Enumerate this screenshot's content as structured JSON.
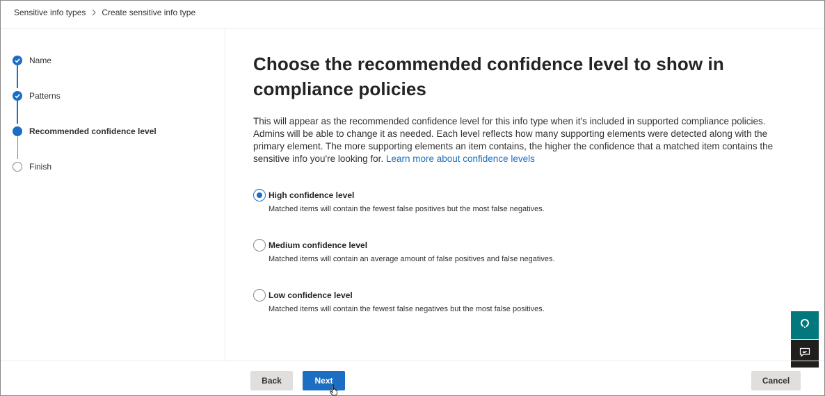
{
  "breadcrumb": {
    "items": [
      "Sensitive info types",
      "Create sensitive info type"
    ]
  },
  "steps": [
    {
      "label": "Name",
      "state": "done"
    },
    {
      "label": "Patterns",
      "state": "done"
    },
    {
      "label": "Recommended confidence level",
      "state": "current"
    },
    {
      "label": "Finish",
      "state": "todo"
    }
  ],
  "main": {
    "title_line1": "Choose the recommended confidence level to show in",
    "title_line2": "compliance policies",
    "description": "This will appear as the recommended confidence level for this info type when it's included in supported compliance policies. Admins will be able to change it as needed. Each level reflects how many supporting elements were detected along with the primary element. The more supporting elements an item contains, the higher the confidence that a matched item contains the sensitive info you're looking for.",
    "learn_more_link": "Learn more about confidence levels"
  },
  "options": [
    {
      "title": "High confidence level",
      "description": "Matched items will contain the fewest false positives but the most false negatives.",
      "selected": true
    },
    {
      "title": "Medium confidence level",
      "description": "Matched items will contain an average amount of false positives and false negatives.",
      "selected": false
    },
    {
      "title": "Low confidence level",
      "description": "Matched items will contain the fewest false negatives but the most false positives.",
      "selected": false
    }
  ],
  "footer": {
    "back_label": "Back",
    "next_label": "Next",
    "cancel_label": "Cancel"
  },
  "side_buttons": {
    "help_icon": "headset-help-icon",
    "feedback_icon": "feedback-chat-icon"
  },
  "colors": {
    "accent": "#1b6ec2",
    "help_bg": "#03787c",
    "feedback_bg": "#201f1e"
  }
}
